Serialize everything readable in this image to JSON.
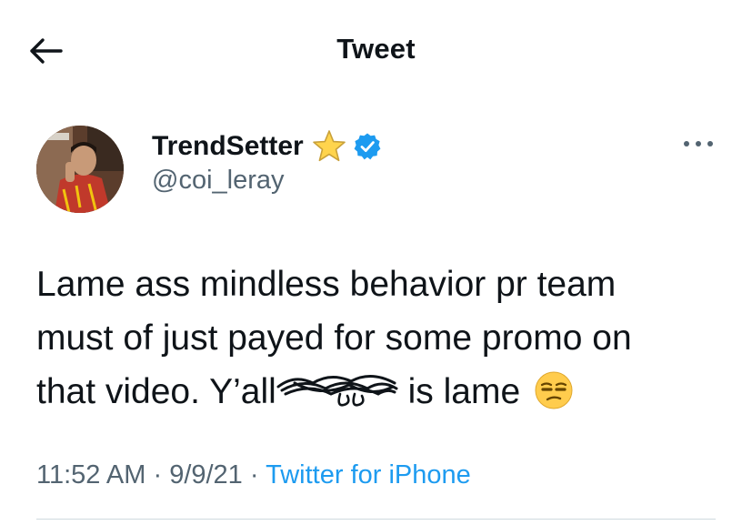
{
  "header": {
    "title": "Tweet",
    "back_icon": "arrow-left-icon"
  },
  "author": {
    "display_name": "TrendSetter",
    "name_emoji": "star-icon",
    "verified_icon": "verified-badge-icon",
    "handle": "@coi_leray",
    "avatar_icon": "avatar-photo"
  },
  "tweet": {
    "line1": "Lame ass mindless behavior pr team",
    "line2": "must of just payed for some promo on",
    "line3_before": "that video. Y’all",
    "line3_after": "is lame",
    "trailing_emoji": "unamused-face-icon"
  },
  "meta": {
    "time": "11:52 AM",
    "date": "9/9/21",
    "source": "Twitter for iPhone",
    "separator": "·"
  },
  "colors": {
    "text": "#0f1419",
    "secondary": "#536471",
    "accent": "#1d9bf0",
    "divider": "#cfd9de"
  }
}
